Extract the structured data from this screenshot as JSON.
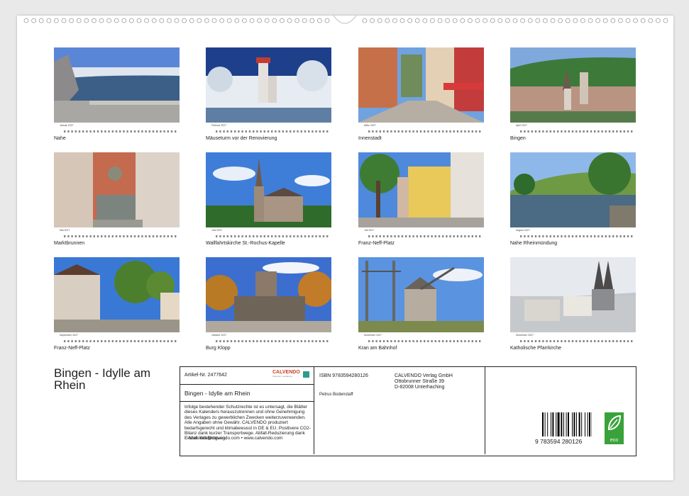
{
  "title": "Bingen - Idylle am Rhein",
  "months": [
    {
      "month": "Januar 2027",
      "caption": "Nahe"
    },
    {
      "month": "Februar 2027",
      "caption": "Mäuseturm vor der Renovierung"
    },
    {
      "month": "März 2027",
      "caption": "Innenstadt"
    },
    {
      "month": "April 2027",
      "caption": "Bingen"
    },
    {
      "month": "Mai 2027",
      "caption": "Marktbrunnen"
    },
    {
      "month": "Juni 2027",
      "caption": "Wallfahrtskirche St.-Rochus-Kapelle"
    },
    {
      "month": "Juli 2027",
      "caption": "Franz-Neff-Platz"
    },
    {
      "month": "August 2027",
      "caption": "Nahe Rheinmündung"
    },
    {
      "month": "September 2027",
      "caption": "Franz-Neff-Platz"
    },
    {
      "month": "Oktober 2027",
      "caption": "Burg Klopp"
    },
    {
      "month": "November 2027",
      "caption": "Kran am Bahnhof"
    },
    {
      "month": "Dezember 2027",
      "caption": "Katholische Pfarrkirche"
    }
  ],
  "info": {
    "article": "Artikel-Nr. 2477642",
    "brand": "CALVENDO",
    "brand_sub": "Kalender. Gestaltung",
    "box_title": "Bingen - Idylle am Rhein",
    "legal": "Infolge bestehender Schutzrechte ist es untersagt, die Blätter dieses Kalenders herauszutrennen und ohne Genehmigung des Verlages zu gewerblichen Zwecken weiterzuverwenden. Alle Angaben ohne Gewähr. CALVENDO produziert bedarfsgerecht und klimabewusst in DE & EU. Positivere CO2-Bilanz dank kurzer Transportwege. Abfall-Reduzierung dank Einzelstückfertigung.",
    "email": "E-Mail: info@calvendo.com • www.calvendo.com",
    "isbn": "ISBN 9783594280126",
    "author": "Petrus Bodenstaff",
    "publisher1": "CALVENDO Verlag GmbH",
    "publisher2": "Ottobrunner Straße 39",
    "publisher3": "D-82008 Unterhaching",
    "barcode_digits": "9 783594 280126",
    "eco": "eco"
  }
}
